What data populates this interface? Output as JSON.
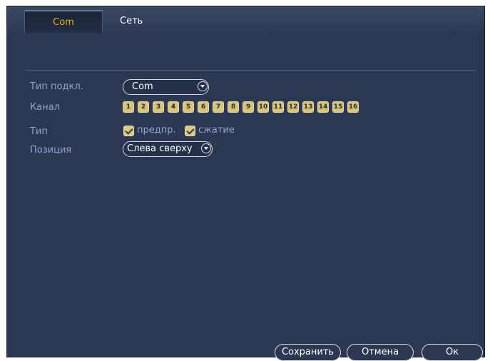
{
  "tabs": [
    {
      "label": "Com"
    },
    {
      "label": "Сеть"
    }
  ],
  "form": {
    "connection_type": {
      "label": "Тип подкл.",
      "value": "Com"
    },
    "channel": {
      "label": "Канал",
      "channels": [
        "1",
        "2",
        "3",
        "4",
        "5",
        "6",
        "7",
        "8",
        "9",
        "10",
        "11",
        "12",
        "13",
        "14",
        "15",
        "16"
      ]
    },
    "type": {
      "label": "Тип",
      "options": [
        {
          "label": "предпр.",
          "checked": true
        },
        {
          "label": "сжатие",
          "checked": true
        }
      ]
    },
    "position": {
      "label": "Позиция",
      "value": "Слева сверху"
    }
  },
  "buttons": {
    "save": "Сохранить",
    "cancel": "Отмена",
    "ok": "Ок"
  },
  "colors": {
    "background": "#2c3752",
    "active_tab_text": "#e8b400",
    "label_text": "#8ea6cf",
    "checkbox_fill": "#dccb82"
  }
}
